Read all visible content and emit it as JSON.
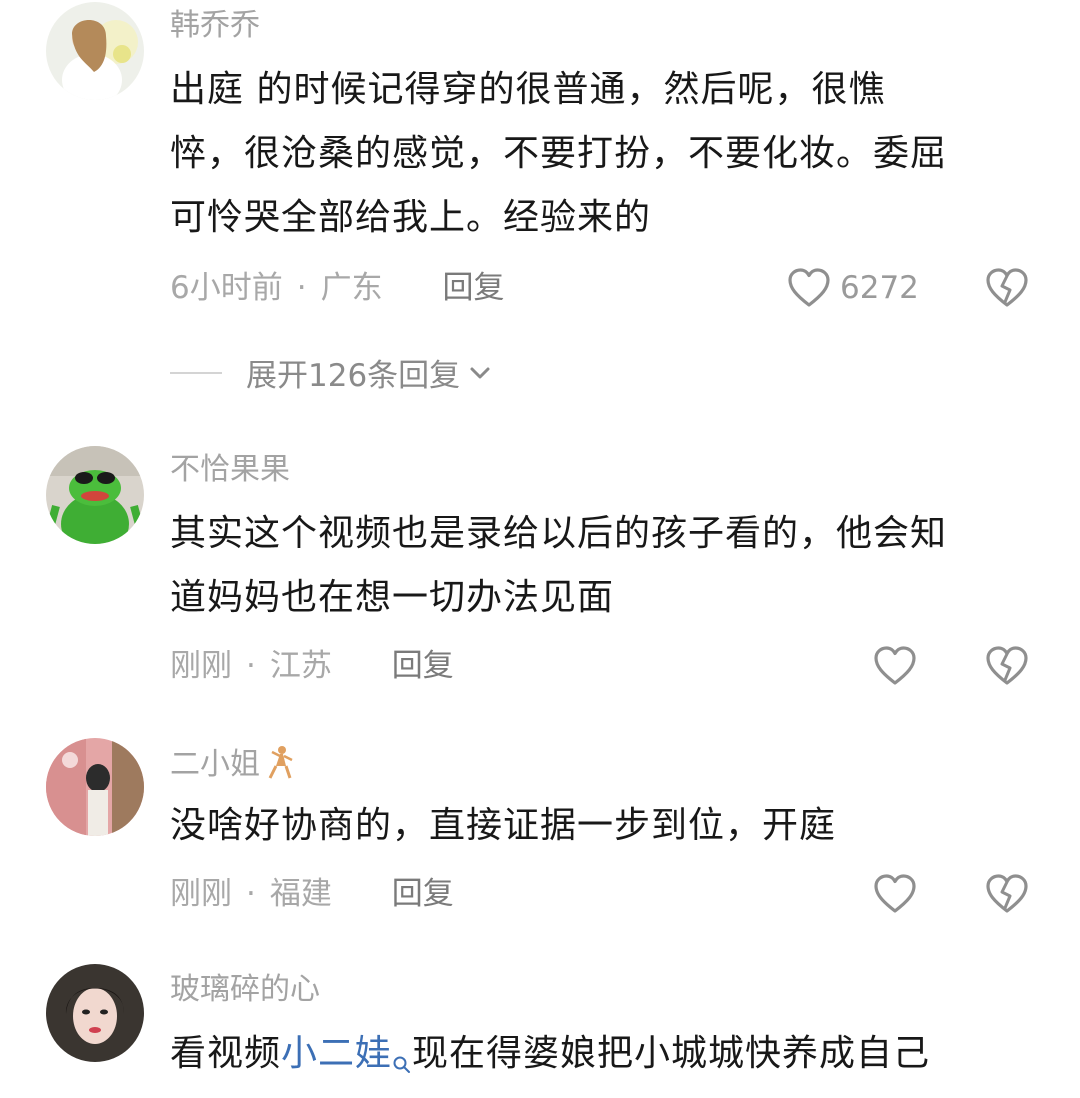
{
  "comments": [
    {
      "username": "韩乔乔",
      "text_line1": "出庭 的时候记得穿的很普通，然后呢，很憔",
      "text_line2": "悴，很沧桑的感觉，不要打扮，不要化妆。委屈",
      "text_line3": "可怜哭全部给我上。经验来的",
      "time": "6小时前",
      "location": "广东",
      "reply_label": "回复",
      "like_count": "6272",
      "expand_label": "展开126条回复"
    },
    {
      "username": "不恰果果",
      "text_line1": "其实这个视频也是录给以后的孩子看的，他会知",
      "text_line2": "道妈妈也在想一切办法见面",
      "time": "刚刚",
      "location": "江苏",
      "reply_label": "回复"
    },
    {
      "username": "二小姐",
      "text_line1": "没啥好协商的，直接证据一步到位，开庭",
      "time": "刚刚",
      "location": "福建",
      "reply_label": "回复"
    },
    {
      "username": "玻璃碎的心",
      "text_prefix": "看视频",
      "hashtag": "小二娃",
      "text_suffix": "现在得婆娘把小城城快养成自己"
    }
  ],
  "separator": "·",
  "icons": {
    "like": "heart-outline-icon",
    "dislike": "broken-heart-icon",
    "expand": "chevron-down-icon",
    "search": "search-icon"
  },
  "colors": {
    "text": "#181818",
    "secondary": "#a8a8a8",
    "link": "#3c6fb5"
  }
}
